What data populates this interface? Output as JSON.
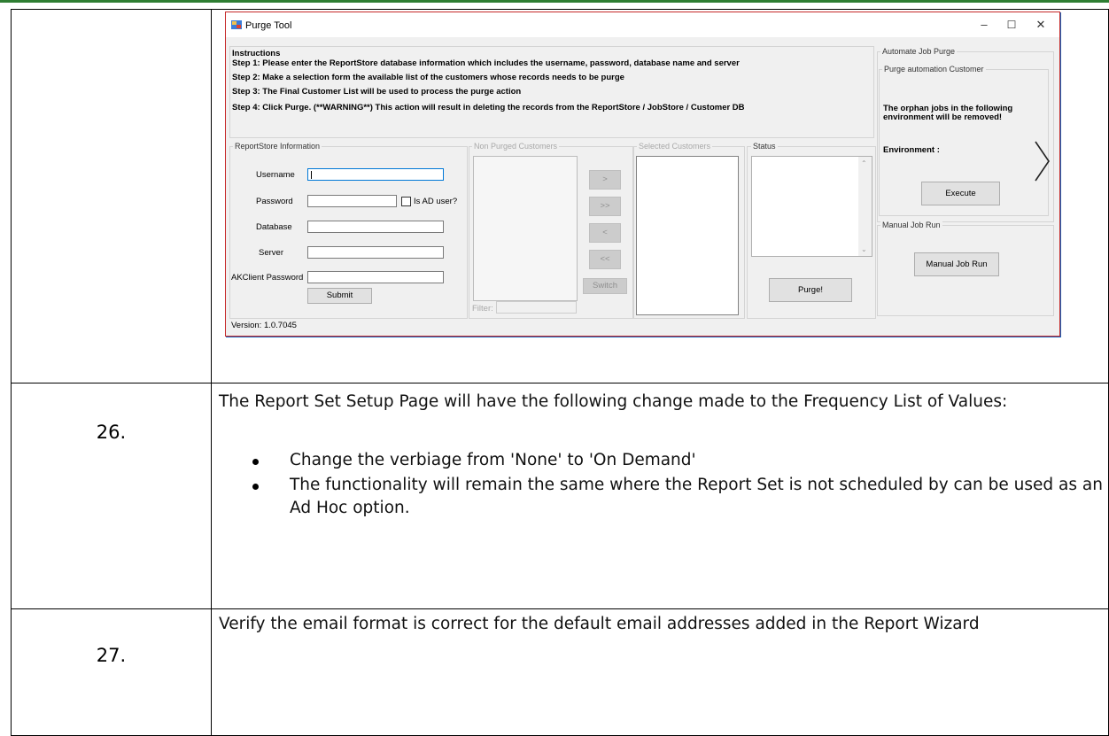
{
  "purge_tool": {
    "window_title": "Purge Tool",
    "window_controls": {
      "minimize": "–",
      "maximize": "☐",
      "close": "✕"
    },
    "instructions": {
      "title": "Instructions",
      "step1": "Step 1: Please enter the ReportStore database information which includes the username, password, database name and server",
      "step2": "Step 2: Make a selection form the available list of the customers whose records needs to be purge",
      "step3": "Step 3: The Final Customer List will be used to process the purge action",
      "step4": "Step 4: Click Purge. (**WARNING**) This action will result in deleting the records from the ReportStore / JobStore / Customer DB"
    },
    "reportstore": {
      "group_label": "ReportStore Information",
      "username_label": "Username",
      "password_label": "Password",
      "is_ad_user_label": "Is AD user?",
      "database_label": "Database",
      "server_label": "Server",
      "akclient_label": "AKClient Password",
      "submit_label": "Submit"
    },
    "non_purged": {
      "group_label": "Non Purged Customers",
      "filter_label": "Filter:"
    },
    "move_buttons": {
      "right": ">",
      "all_right": ">>",
      "left": "<",
      "all_left": "<<",
      "switch": "Switch"
    },
    "selected": {
      "group_label": "Selected Customers"
    },
    "status": {
      "group_label": "Status",
      "purge_label": "Purge!"
    },
    "automate": {
      "group_label": "Automate Job Purge",
      "customer_group_label": "Purge automation Customer",
      "warning": "The orphan jobs in the following environment will be removed!",
      "environment_label": "Environment :",
      "execute_label": "Execute"
    },
    "manual": {
      "group_label": "Manual Job Run",
      "button_label": "Manual Job Run"
    },
    "version": "Version:  1.0.7045"
  },
  "rows": [
    {
      "number": "26.",
      "text": "The Report Set Setup Page will have the following change made to the Frequency List of Values:",
      "bullets": [
        "Change the verbiage from 'None' to 'On Demand'",
        "The functionality will remain the same where the Report Set is not scheduled by can be used as an Ad Hoc option."
      ]
    },
    {
      "number": "27.",
      "text": "Verify the email format is correct for the default email addresses added in the Report Wizard"
    }
  ],
  "colors": {
    "top_rule": "#2e7d32",
    "window_border": "#c62828",
    "focus_border": "#0078d7"
  },
  "icons": {
    "app": "purge-tool-app-icon",
    "next": "chevron-right-icon"
  }
}
